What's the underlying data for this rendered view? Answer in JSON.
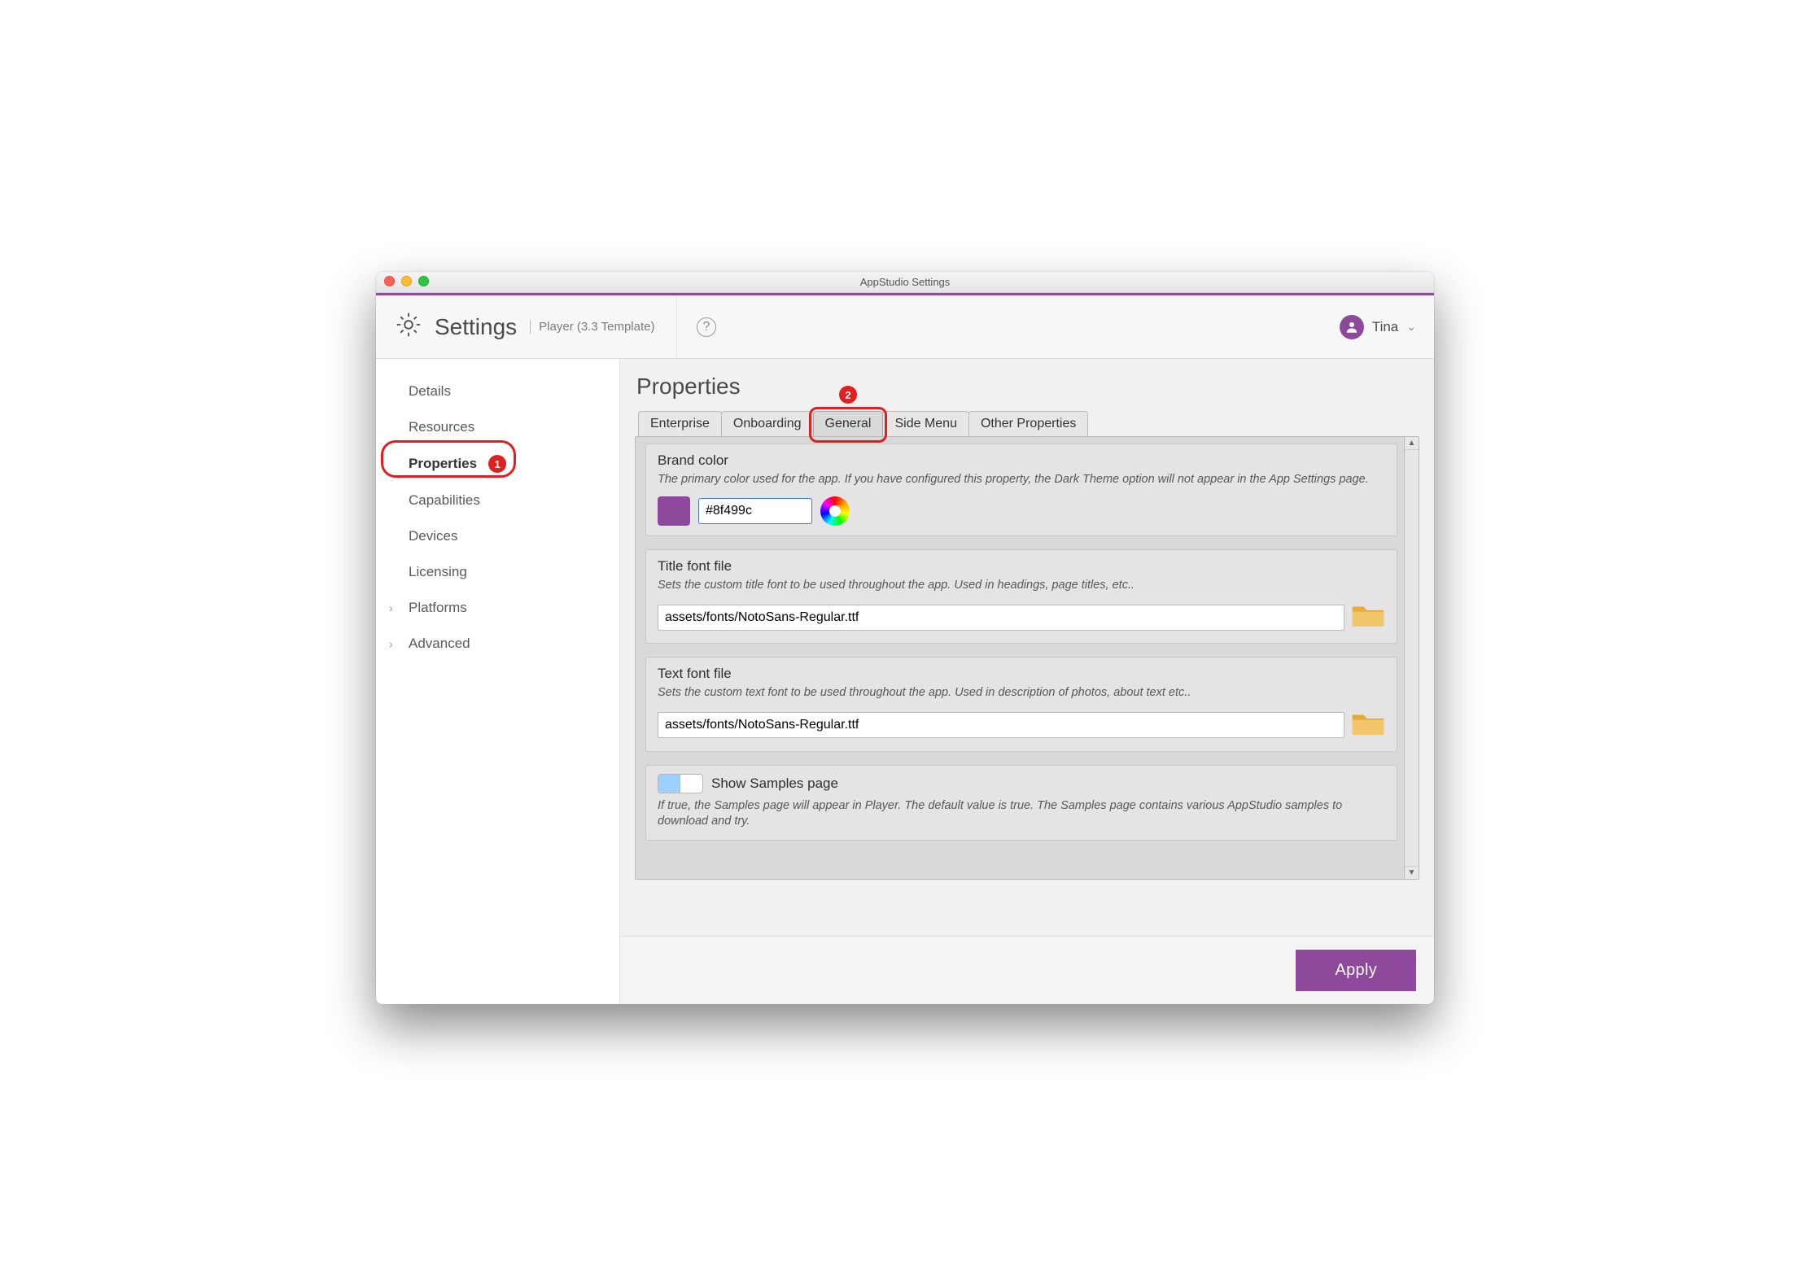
{
  "window": {
    "title": "AppStudio Settings"
  },
  "header": {
    "title": "Settings",
    "subtitle": "Player (3.3 Template)",
    "user": "Tina"
  },
  "sidebar": {
    "items": [
      {
        "label": "Details"
      },
      {
        "label": "Resources"
      },
      {
        "label": "Properties",
        "active": true
      },
      {
        "label": "Capabilities"
      },
      {
        "label": "Devices"
      },
      {
        "label": "Licensing"
      },
      {
        "label": "Platforms",
        "expandable": true
      },
      {
        "label": "Advanced",
        "expandable": true
      }
    ]
  },
  "page": {
    "title": "Properties"
  },
  "tabs": {
    "items": [
      {
        "label": "Enterprise"
      },
      {
        "label": "Onboarding"
      },
      {
        "label": "General",
        "active": true
      },
      {
        "label": "Side Menu"
      },
      {
        "label": "Other Properties"
      }
    ]
  },
  "props": {
    "brand": {
      "title": "Brand color",
      "desc": "The primary color used for the app. If you have configured this property, the Dark Theme option will not appear in the App Settings page.",
      "value": "#8f499c",
      "swatch": "#8f499c"
    },
    "titlefont": {
      "title": "Title font file",
      "desc": "Sets the custom title font to be used throughout the app. Used in headings, page titles, etc..",
      "value": "assets/fonts/NotoSans-Regular.ttf"
    },
    "textfont": {
      "title": "Text font file",
      "desc": "Sets the custom text font to be used throughout the app. Used in description of photos, about text etc..",
      "value": "assets/fonts/NotoSans-Regular.ttf"
    },
    "samples": {
      "title": "Show Samples page",
      "desc": "If true, the Samples page will appear in Player. The default value is true. The Samples page contains various AppStudio samples to download and try.",
      "value": true
    }
  },
  "footer": {
    "apply": "Apply"
  },
  "annotations": {
    "a1": "1",
    "a2": "2"
  }
}
